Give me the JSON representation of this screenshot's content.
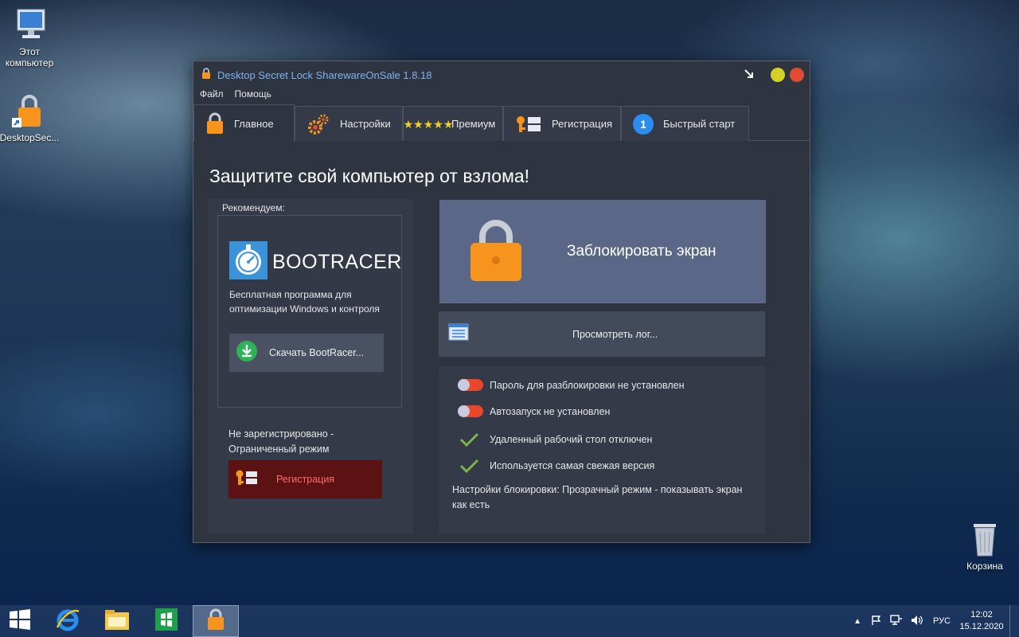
{
  "desktop": {
    "icons": [
      {
        "label": "Этот компьютер"
      },
      {
        "label": "DesktopSec..."
      },
      {
        "label": "Корзина"
      }
    ]
  },
  "window": {
    "title": "Desktop Secret Lock SharewareOnSale 1.8.18",
    "menu": [
      "Файл",
      "Помощь"
    ],
    "tabs": [
      {
        "label": "Главное",
        "icon": "lock-icon"
      },
      {
        "label": "Настройки",
        "icon": "gears-icon"
      },
      {
        "label": "Премиум",
        "icon": "stars-icon"
      },
      {
        "label": "Регистрация",
        "icon": "key-icon"
      },
      {
        "label": "Быстрый старт",
        "icon": "number-one-icon"
      }
    ],
    "quick_start_number": "1"
  },
  "main": {
    "heading": "Защитите свой компьютер от взлома!",
    "recommend_label": "Рекомендуем:",
    "bootracer": {
      "name": "BOOTRACER",
      "description": "Бесплатная программа для оптимизации Windows и контроля",
      "download_label": "Скачать BootRacer..."
    },
    "unregistered_text": "Не зарегистрировано - Ограниченный режим",
    "register_label": "Регистрация",
    "lock_screen_label": "Заблокировать экран",
    "view_log_label": "Просмотреть лог...",
    "status": [
      {
        "text": "Пароль для разблокировки не установлен",
        "icon": "toggle-off-icon"
      },
      {
        "text": "Автозапуск не установлен",
        "icon": "toggle-off-icon"
      },
      {
        "text": "Удаленный рабочий стол отключен",
        "icon": "check-icon"
      },
      {
        "text": "Используется самая свежая версия",
        "icon": "check-icon"
      }
    ],
    "lock_settings": "Настройки блокировки: Прозрачный режим - показывать экран как есть"
  },
  "taskbar": {
    "language": "РУС",
    "time": "12:02",
    "date": "15.12.2020"
  },
  "colors": {
    "accent_orange": "#f7941d",
    "title_blue": "#7fb2ef",
    "toggle_red": "#e8472c",
    "check_green": "#7ab648",
    "register_bg": "#5c1112"
  }
}
